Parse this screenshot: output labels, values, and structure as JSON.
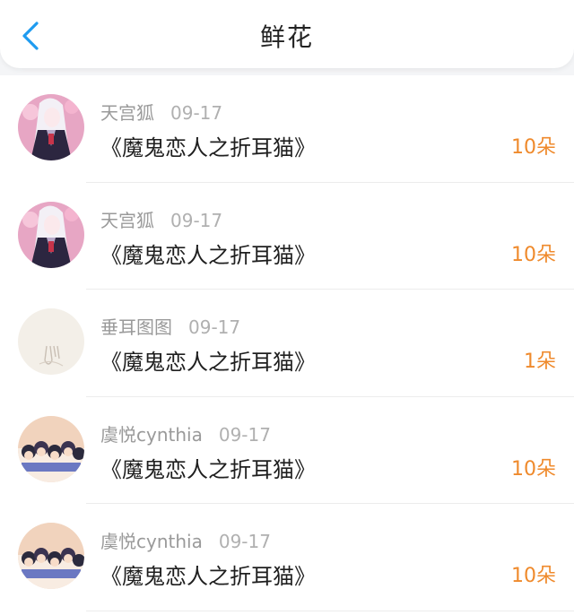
{
  "header": {
    "title": "鲜花",
    "back_icon": "chevron-left-icon"
  },
  "colors": {
    "accent_blue": "#1e9bf0",
    "count_orange": "#ef8a2c"
  },
  "items": [
    {
      "user": "天宫狐",
      "date": "09-17",
      "book": "《魔鬼恋人之折耳猫》",
      "count": "10朵",
      "avatar": "anime-character-avatar-pink"
    },
    {
      "user": "天宫狐",
      "date": "09-17",
      "book": "《魔鬼恋人之折耳猫》",
      "count": "10朵",
      "avatar": "anime-character-avatar-pink"
    },
    {
      "user": "垂耳图图",
      "date": "09-17",
      "book": "《魔鬼恋人之折耳猫》",
      "count": "1朵",
      "avatar": "bunny-sketch-avatar"
    },
    {
      "user": "虞悦cynthia",
      "date": "09-17",
      "book": "《魔鬼恋人之折耳猫》",
      "count": "10朵",
      "avatar": "group-cartoon-avatar"
    },
    {
      "user": "虞悦cynthia",
      "date": "09-17",
      "book": "《魔鬼恋人之折耳猫》",
      "count": "10朵",
      "avatar": "group-cartoon-avatar"
    }
  ]
}
